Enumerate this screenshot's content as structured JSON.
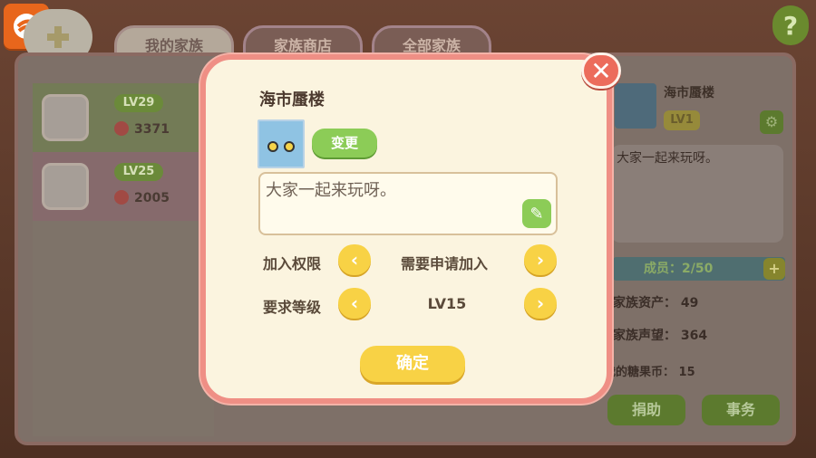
{
  "tabs": [
    {
      "label": "我的家族"
    },
    {
      "label": "家族商店"
    },
    {
      "label": "全部家族"
    }
  ],
  "family_list": [
    {
      "level": "LV29",
      "score": "3371"
    },
    {
      "level": "LV25",
      "score": "2005"
    }
  ],
  "right_panel": {
    "name": "海市蜃楼",
    "level": "LV1",
    "motto": "大家一起来玩呀。",
    "members": "成员：2/50",
    "assets_label": "家族资产：",
    "assets_value": "49",
    "fame_label": "家族声望：",
    "fame_value": "364",
    "coins_label": "我的糖果币：",
    "coins_value": "15",
    "donate_label": "捐助",
    "affairs_label": "事务"
  },
  "modal": {
    "title": "海市蜃楼",
    "change_label": "变更",
    "motto": "大家一起来玩呀。",
    "join_label": "加入权限",
    "join_value": "需要申请加入",
    "level_label": "要求等级",
    "level_value": "LV15",
    "confirm_label": "确定"
  },
  "help_label": "?",
  "close_label": "✕"
}
